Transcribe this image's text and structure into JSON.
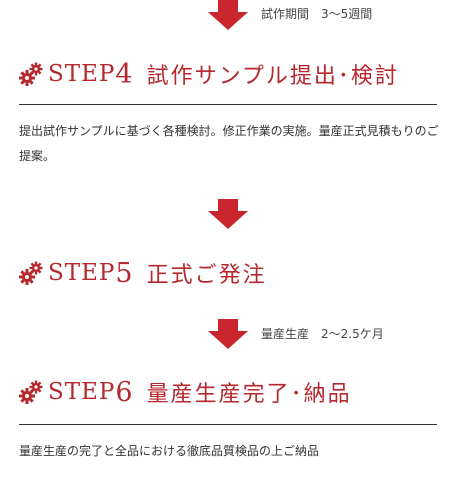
{
  "flow": [
    {
      "duration": "試作期間　3〜5週間"
    },
    {
      "step_label": "STEP",
      "step_number": "4",
      "title": "試作サンプル提出･検討",
      "description": "提出試作サンプルに基づく各種検討。修正作業の実施。量産正式見積もりのご提案。"
    },
    {
      "duration": ""
    },
    {
      "step_label": "STEP",
      "step_number": "5",
      "title": "正式ご発注"
    },
    {
      "duration": "量産生産　2〜2.5ケ月"
    },
    {
      "step_label": "STEP",
      "step_number": "6",
      "title": "量産生産完了･納品",
      "description": "量産生産の完了と全品における徹底品質検品の上ご納品"
    }
  ],
  "colors": {
    "accent": "#b5282e",
    "text": "#333333",
    "rule": "#333333"
  },
  "icons": {
    "arrow": "down-arrow-icon",
    "step": "gears-icon"
  }
}
